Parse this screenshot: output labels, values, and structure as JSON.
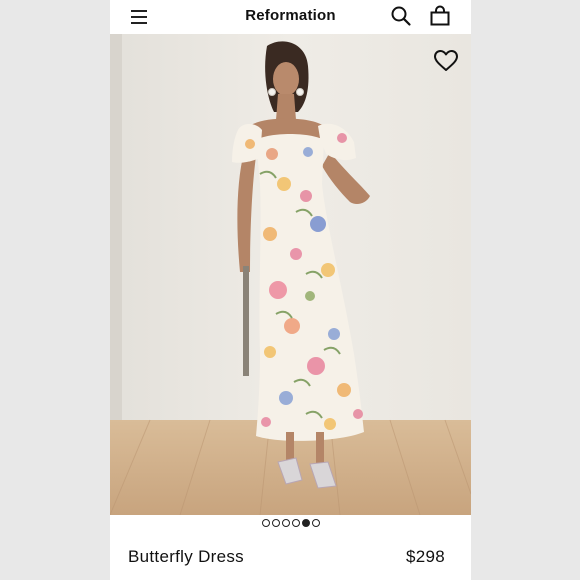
{
  "header": {
    "brand": "Reformation",
    "icons": [
      "menu-icon",
      "search-icon",
      "bag-icon"
    ]
  },
  "hero": {
    "favorite_icon": "heart-icon",
    "carousel_total": 6,
    "carousel_active": 5
  },
  "product": {
    "name": "Butterfly Dress",
    "price": "$298"
  },
  "colors": {
    "wall": "#ece9e3",
    "floor": "#cfae8a",
    "text": "#111111"
  }
}
